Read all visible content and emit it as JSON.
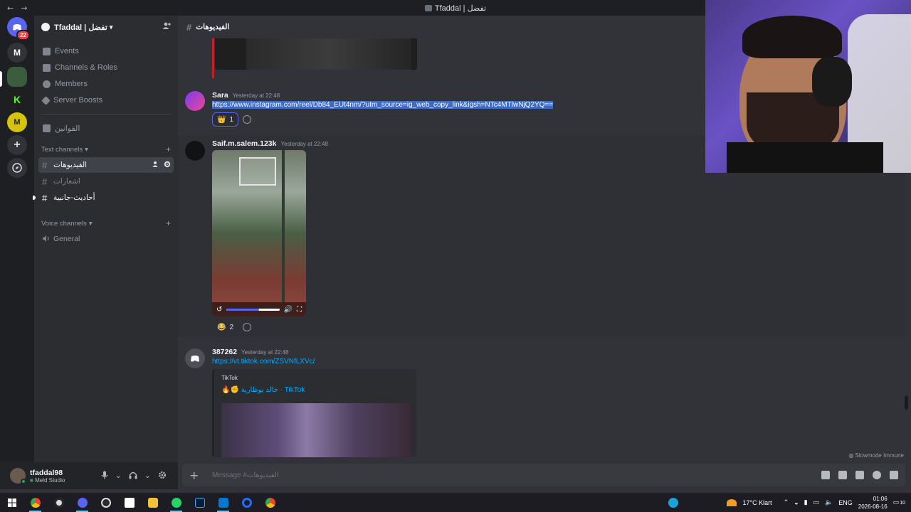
{
  "window": {
    "title": "Tfaddal | تفضل",
    "back": "←",
    "forward": "→"
  },
  "servers": {
    "dm_badge": "22",
    "items": [
      {
        "label": "M"
      }
    ]
  },
  "sidebar": {
    "server_name": "Tfaddal | تفضل",
    "menu": [
      {
        "label": "Events"
      },
      {
        "label": "Channels & Roles"
      },
      {
        "label": "Members"
      },
      {
        "label": "Server Boosts"
      }
    ],
    "rules_channel": "القوانين",
    "text_category": "Text channels",
    "text_channels": [
      {
        "label": "الفيديوهات",
        "active": true
      },
      {
        "label": "اشعارات",
        "active": false
      },
      {
        "label": "أحاديث-جانبية",
        "active": false
      }
    ],
    "voice_category": "Voice channels",
    "voice_channels": [
      {
        "label": "General"
      }
    ]
  },
  "user": {
    "name": "tfaddal98",
    "status": "Meld Studio"
  },
  "chat": {
    "channel_name": "الفيديوهات",
    "messages": [
      {
        "author": "Sara",
        "timestamp": "Yesterday at 22:48",
        "link": "https://www.instagram.com/reel/Db84_EUt4nm/?utm_source=ig_web_copy_link&igsh=NTc4MTlwNjQ2YQ==",
        "reaction": {
          "emoji": "👑",
          "count": "1"
        }
      },
      {
        "author": "Saif.m.salem.123k",
        "timestamp": "Yesterday at 22:48",
        "video_progress": 0.62,
        "reaction": {
          "emoji": "😂",
          "count": "2"
        }
      },
      {
        "author": "387262",
        "timestamp": "Yesterday at 22:48",
        "link": "https://vt.tiktok.com/ZSVNfLXVc/",
        "embed": {
          "provider": "TikTok",
          "title": "🔥✊ خالد بوظارية · TikTok"
        }
      }
    ],
    "slowmode": "Slowmode Immune",
    "composer_placeholder": "Message #الفيديوهات"
  },
  "taskbar": {
    "weather": "17°C  Klart",
    "lang": "ENG",
    "time": "01:06",
    "date": "2026-08-16",
    "notif": "10"
  },
  "colors": {
    "accent": "#5865f2",
    "link": "#00a8fc",
    "selection": "#3d6ac7"
  }
}
